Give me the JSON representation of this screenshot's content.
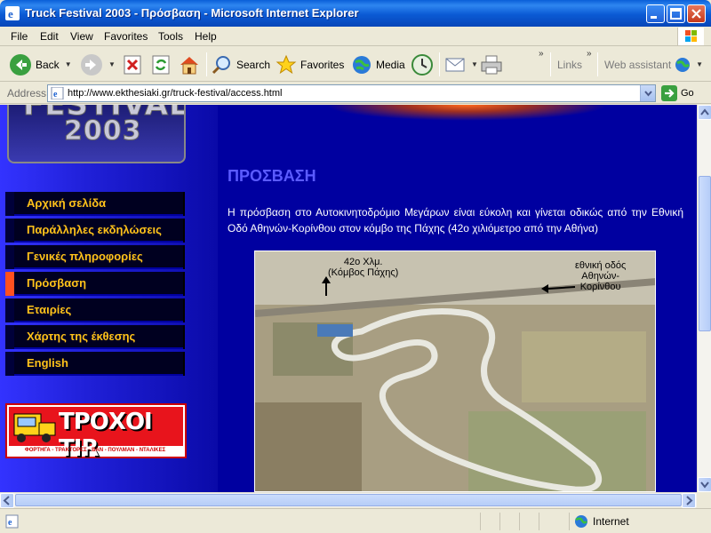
{
  "window": {
    "title": "Truck Festival 2003 - Πρόσβαση - Microsoft Internet Explorer"
  },
  "menu": [
    "File",
    "Edit",
    "View",
    "Favorites",
    "Tools",
    "Help"
  ],
  "toolbar": {
    "back": "Back",
    "search": "Search",
    "favorites": "Favorites",
    "media": "Media",
    "links": "Links",
    "web_assistant": "Web assistant"
  },
  "address": {
    "label": "Address",
    "url": "http://www.ekthesiaki.gr/truck-festival/access.html",
    "go": "Go"
  },
  "sidebar": {
    "logo_line1": "FESTIVAL",
    "logo_line2": "2003",
    "nav": [
      {
        "label": "Αρχική σελίδα",
        "active": false
      },
      {
        "label": "Παράλληλες εκδηλώσεις",
        "active": false
      },
      {
        "label": "Γενικές πληροφορίες",
        "active": false
      },
      {
        "label": "Πρόσβαση",
        "active": true
      },
      {
        "label": "Εταιρίες",
        "active": false
      },
      {
        "label": "Χάρτης της έκθεσης",
        "active": false
      },
      {
        "label": "English",
        "active": false
      }
    ],
    "banner_text": "ΤΡΟΧΟΙ TIR",
    "banner_subtext": "ΦΟΡΤΗΓΑ - ΤΡΑΚΤΟΡΕΣ - ΒΑΝ - ΠΟΥΛΜΑΝ - ΝΤΑΛΙΚΕΣ"
  },
  "main": {
    "title": "ΠΡΟΣΒΑΣΗ",
    "intro": "Η πρόσβαση στο Αυτοκινητοδρόμιο Μεγάρων είναι εύκολη και γίνεται οδικώς από την Εθνική Οδό Αθηνών-Κορίνθου στον κόμβο της Πάχης (42ο χιλιόμετρο από την Αθήνα)",
    "photo_label_left_1": "42ο Χλμ.",
    "photo_label_left_2": "(Κόμβος Πάχης)",
    "photo_label_right_1": "εθνική οδός",
    "photo_label_right_2": "Αθηνών-",
    "photo_label_right_3": "Κορίνθου"
  },
  "status": {
    "zone": "Internet"
  },
  "colors": {
    "nav_text": "#ffc21a",
    "active_marker": "#ff5020",
    "page_title": "#5b5bff"
  }
}
